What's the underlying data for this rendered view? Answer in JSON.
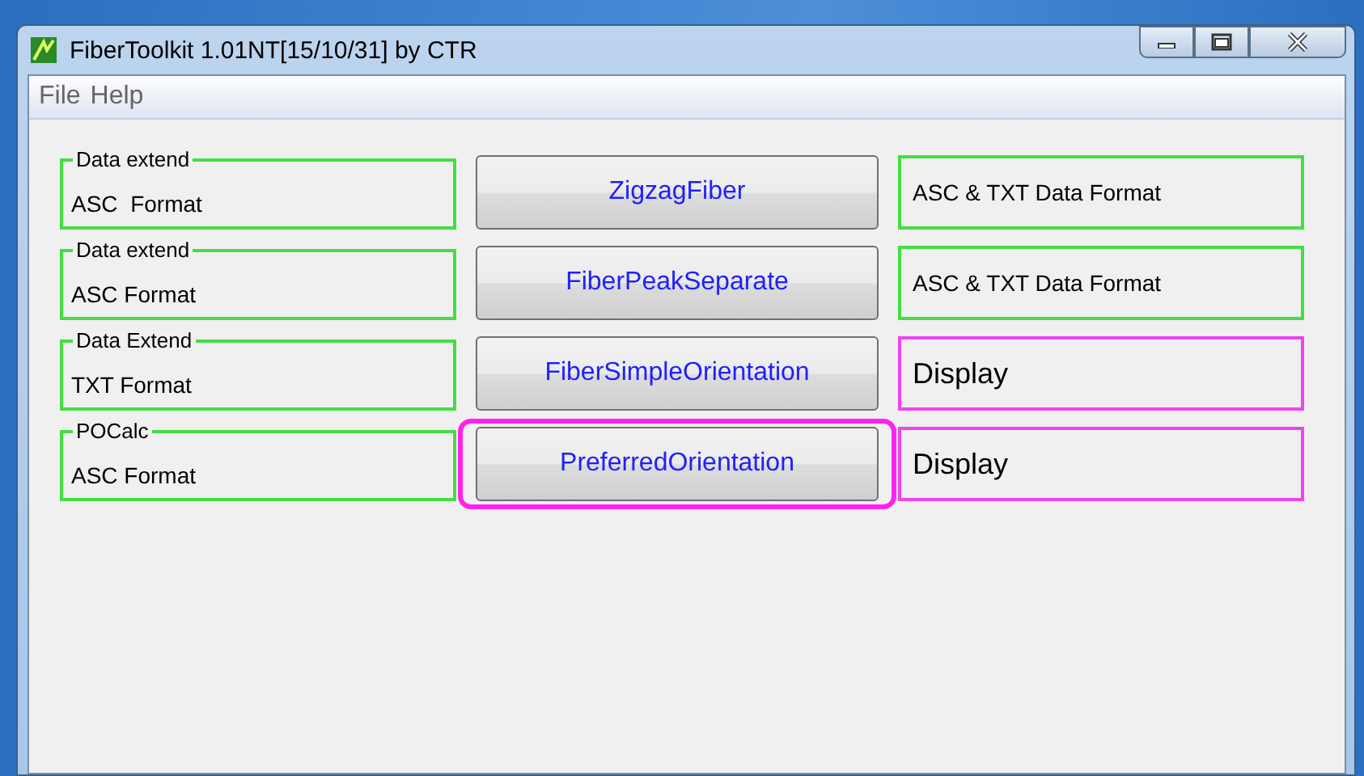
{
  "window": {
    "title": "FiberToolkit 1.01NT[15/10/31] by CTR"
  },
  "menu": [
    "File",
    "Help"
  ],
  "rows": [
    {
      "group": {
        "title": "Data extend",
        "text": "ASC  Format",
        "color": "#44dd44"
      },
      "button": "ZigzagFiber",
      "highlighted": false,
      "output": {
        "kind": "small",
        "text": "ASC & TXT Data Format",
        "color": "#44dd44"
      }
    },
    {
      "group": {
        "title": "Data extend",
        "text": "ASC Format",
        "color": "#44dd44"
      },
      "button": "FiberPeakSeparate",
      "highlighted": false,
      "output": {
        "kind": "small",
        "text": "ASC & TXT Data Format",
        "color": "#44dd44"
      }
    },
    {
      "group": {
        "title": "Data Extend",
        "text": "TXT Format",
        "color": "#44dd44"
      },
      "button": "FiberSimpleOrientation",
      "highlighted": false,
      "output": {
        "kind": "large",
        "text": "Display",
        "color": "#ee44ee"
      }
    },
    {
      "group": {
        "title": "POCalc",
        "text": "ASC Format",
        "color": "#44dd44"
      },
      "button": "PreferredOrientation",
      "highlighted": true,
      "output": {
        "kind": "large",
        "text": "Display",
        "color": "#ee44ee"
      }
    }
  ]
}
